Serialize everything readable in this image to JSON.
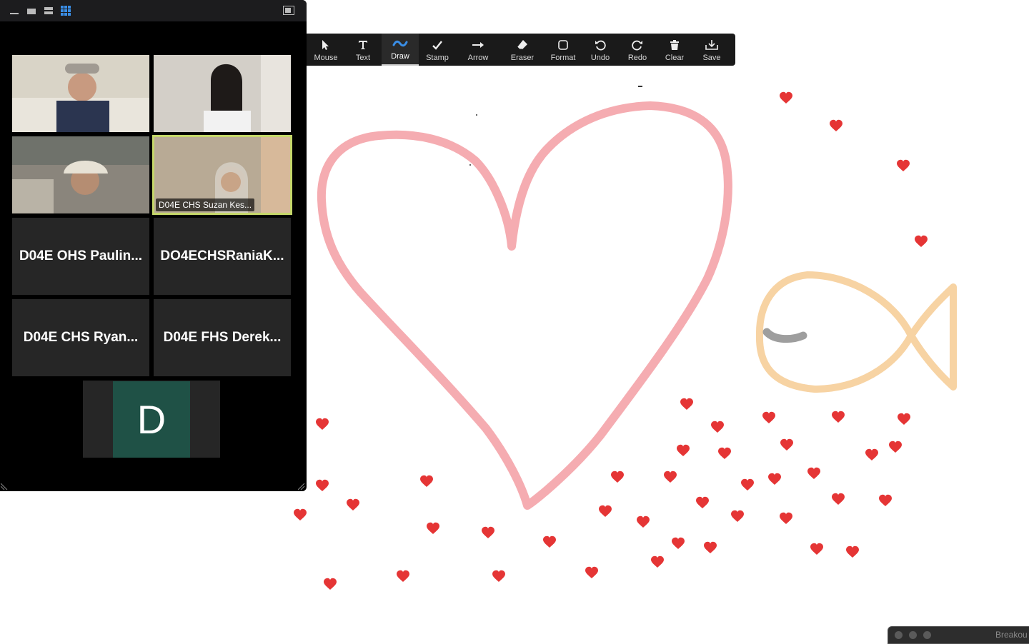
{
  "gallery": {
    "tiles": [
      {
        "name": "",
        "type": "video"
      },
      {
        "name": "",
        "type": "video"
      },
      {
        "name": "",
        "type": "video"
      },
      {
        "name": "D04E CHS Suzan Kes...",
        "type": "video",
        "active": true
      },
      {
        "name": "D04E OHS Paulin...",
        "type": "name"
      },
      {
        "name": "DO4ECHSRaniaK...",
        "type": "name"
      },
      {
        "name": "D04E CHS Ryan...",
        "type": "name"
      },
      {
        "name": "D04E FHS Derek...",
        "type": "name"
      }
    ],
    "self_avatar_letter": "D",
    "avatar_color": "#1f5146"
  },
  "toolbar": {
    "tools": [
      {
        "label": "Mouse",
        "icon": "cursor-arrow-icon"
      },
      {
        "label": "Text",
        "icon": "text-t-icon"
      },
      {
        "label": "Draw",
        "icon": "squiggle-icon",
        "selected": true
      },
      {
        "label": "Stamp",
        "icon": "checkmark-icon"
      },
      {
        "label": "Arrow",
        "icon": "arrow-right-icon"
      },
      {
        "label": "Eraser",
        "icon": "eraser-icon"
      },
      {
        "label": "Format",
        "icon": "rounded-square-icon"
      },
      {
        "label": "Undo",
        "icon": "undo-icon"
      },
      {
        "label": "Redo",
        "icon": "redo-icon"
      },
      {
        "label": "Clear",
        "icon": "trash-icon"
      },
      {
        "label": "Save",
        "icon": "save-tray-icon"
      }
    ]
  },
  "breakout": {
    "label": "Breakou"
  },
  "colors": {
    "heart_stroke": "#f4a3a8",
    "fish_stroke": "#f7d3a3",
    "fish_eye": "#9e9e9e",
    "stamp_heart": "#e53535",
    "draw_accent": "#3a8ee6",
    "active_speaker": "#c5d76a"
  }
}
